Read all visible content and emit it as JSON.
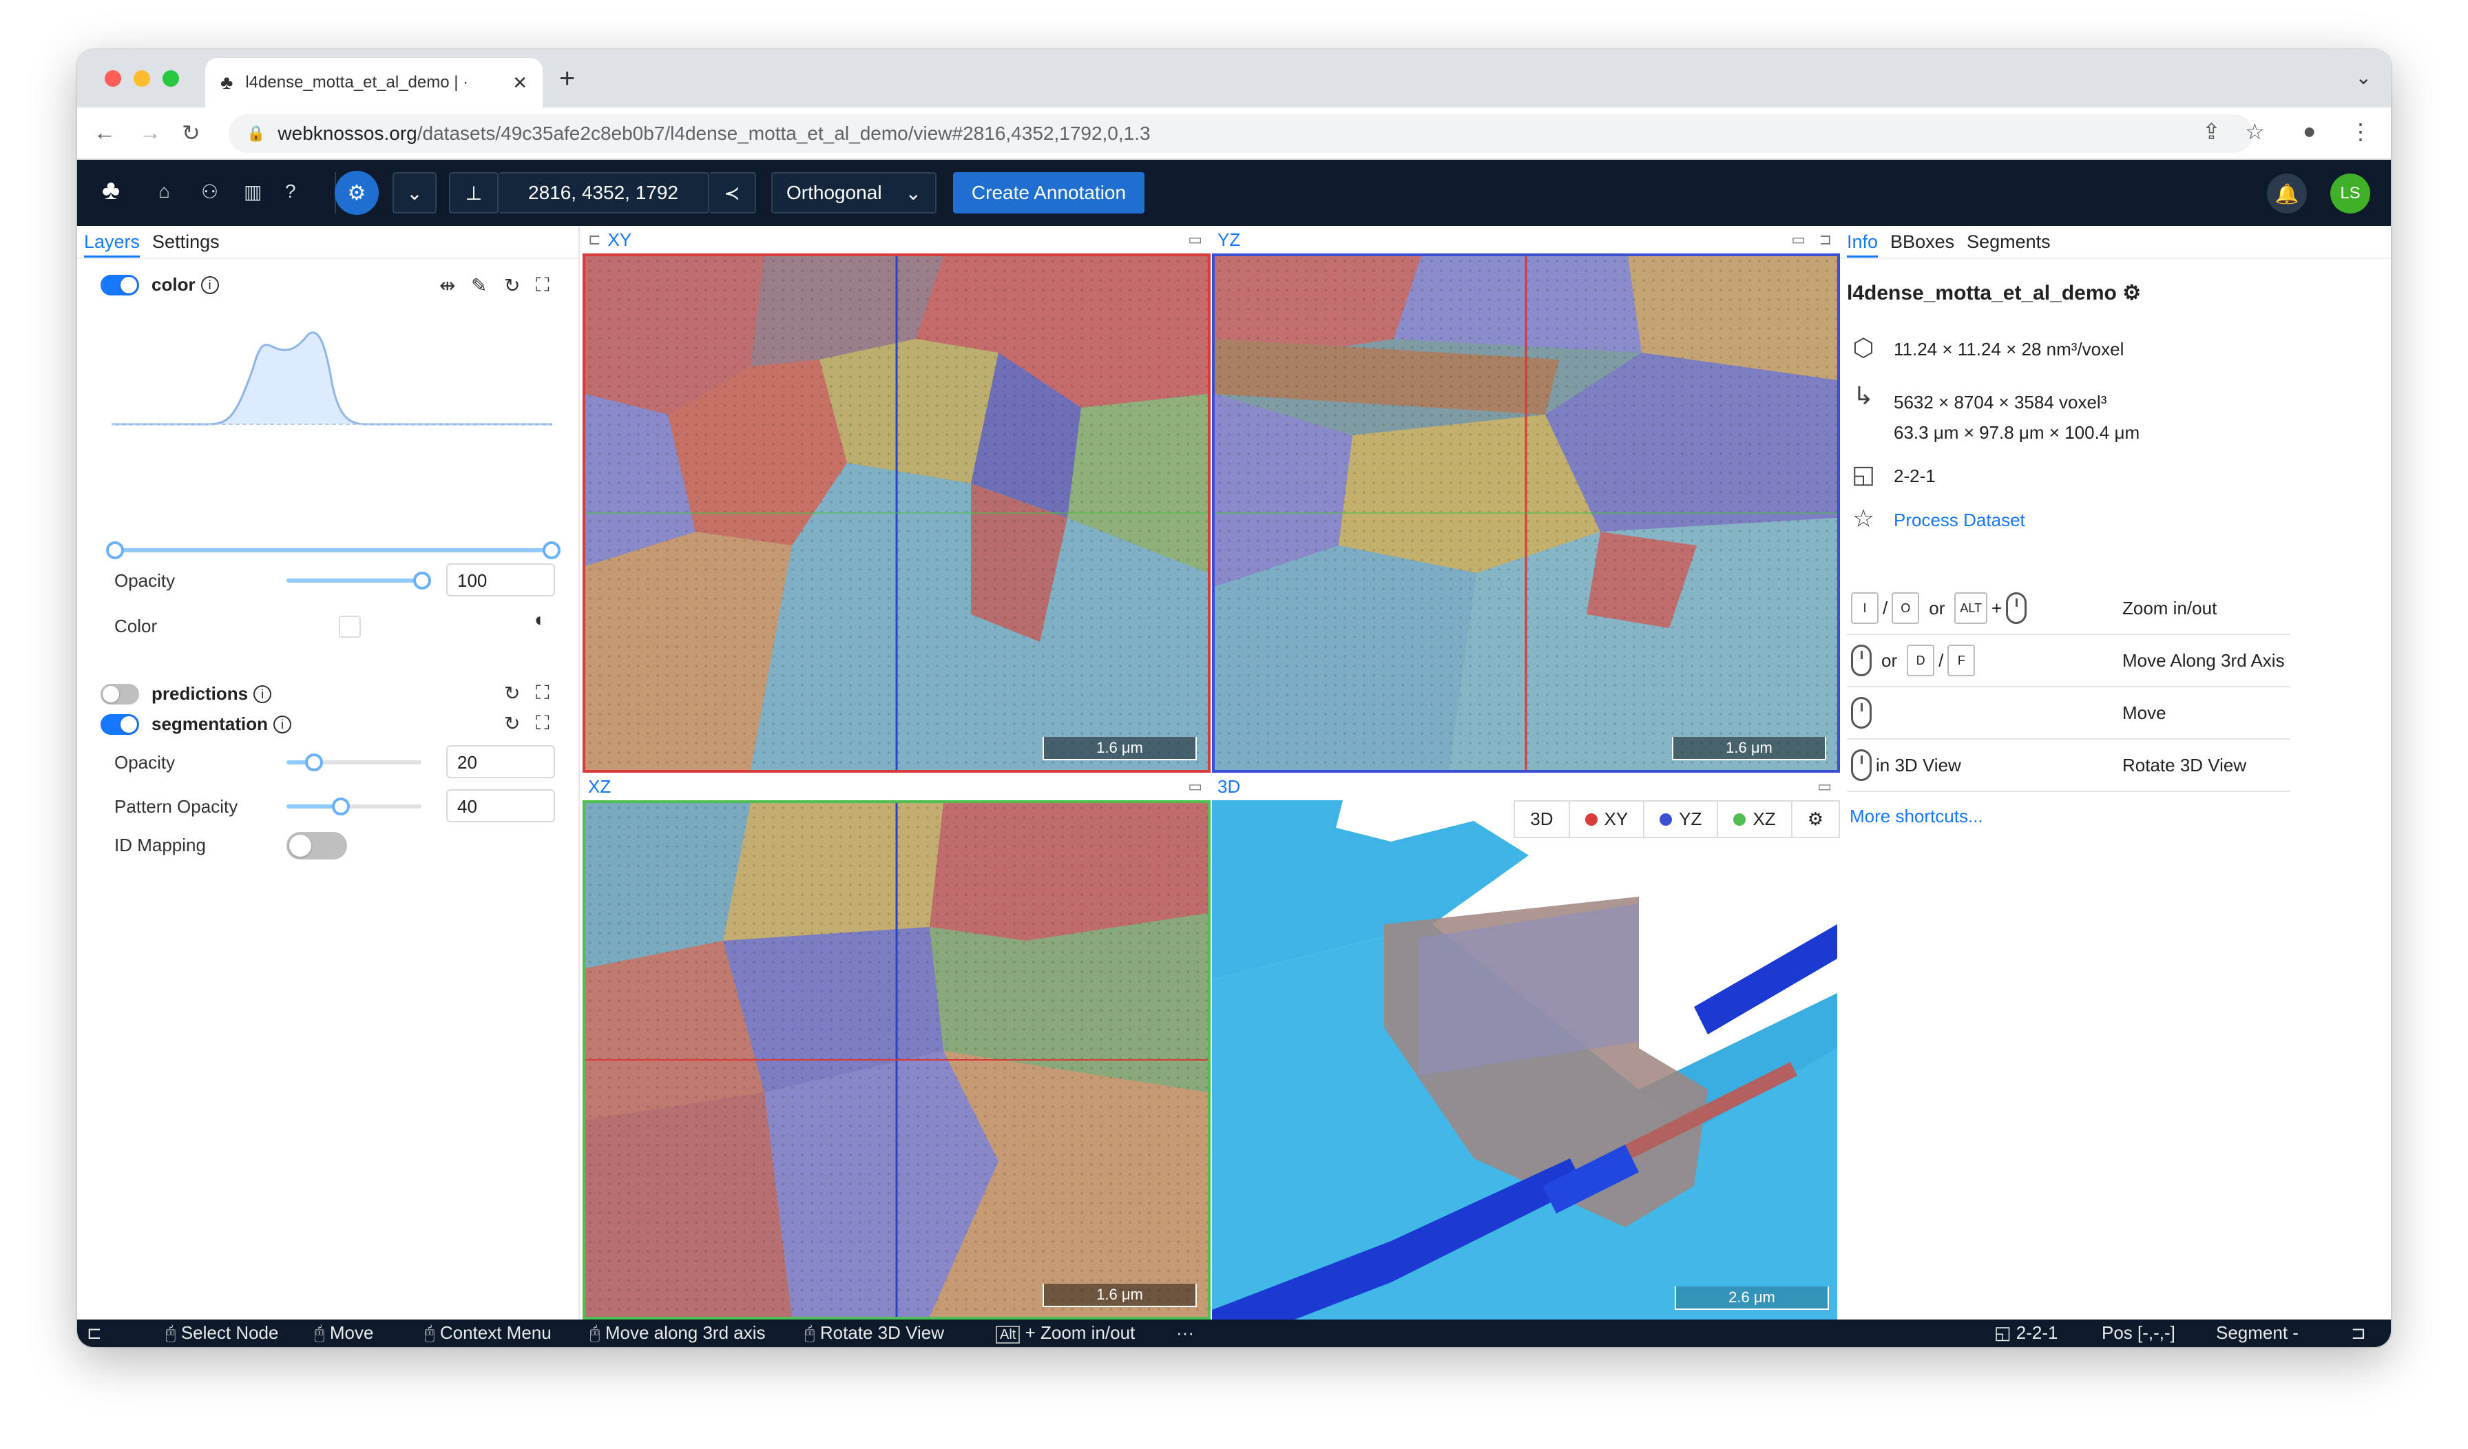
{
  "browser": {
    "tab_title": "l4dense_motta_et_al_demo | ·",
    "new_tab": "+",
    "url_domain": "webknossos.org",
    "url_path": "/datasets/49c35afe2c8eb0b7/l4dense_motta_et_al_demo/view#2816,4352,1792,0,1.3"
  },
  "navbar": {
    "position": "2816, 4352, 1792",
    "view_mode": "Orthogonal",
    "create_annotation": "Create Annotation",
    "user_initials": "LS"
  },
  "left_panel": {
    "tabs": [
      "Layers",
      "Settings"
    ],
    "color_layer": {
      "name": "color",
      "enabled": true,
      "opacity_label": "Opacity",
      "opacity": "100",
      "color_label": "Color"
    },
    "predictions_layer": {
      "name": "predictions",
      "enabled": false
    },
    "segmentation_layer": {
      "name": "segmentation",
      "enabled": true,
      "opacity_label": "Opacity",
      "opacity": "20",
      "pattern_label": "Pattern Opacity",
      "pattern_opacity": "40",
      "id_mapping_label": "ID Mapping",
      "id_mapping_enabled": false
    }
  },
  "viewports": {
    "xy": {
      "label": "XY",
      "scale": "1.6 μm",
      "border_color": "#d93a3a"
    },
    "yz": {
      "label": "YZ",
      "scale": "1.6 μm",
      "border_color": "#3a4fd1"
    },
    "xz": {
      "label": "XZ",
      "scale": "1.6 μm",
      "border_color": "#4fbf4f"
    },
    "td": {
      "label": "3D",
      "scale": "2.6 μm",
      "buttons": [
        "3D",
        "XY",
        "YZ",
        "XZ"
      ]
    }
  },
  "right_panel": {
    "tabs": [
      "Info",
      "BBoxes",
      "Segments"
    ],
    "dataset_name": "l4dense_motta_et_al_demo",
    "voxel_size": "11.24 × 11.24 × 28 nm³/voxel",
    "extent_voxel": "5632 × 8704 × 3584 voxel³",
    "extent_um": "63.3 μm × 97.8 μm × 100.4 μm",
    "mag": "2-2-1",
    "process": "Process Dataset",
    "shortcuts": {
      "zoom": {
        "k1": "I",
        "sep": "/",
        "k2": "O",
        "or": "or",
        "k3": "ALT",
        "plus": "+",
        "label": "Zoom in/out"
      },
      "move3rd": {
        "or": "or",
        "k1": "D",
        "sep": "/",
        "k2": "F",
        "label": "Move Along 3rd Axis"
      },
      "move": {
        "label": "Move"
      },
      "rotate": {
        "prefix": "in 3D View",
        "label": "Rotate 3D View"
      },
      "more": "More shortcuts..."
    }
  },
  "statusbar": {
    "select_node": "Select Node",
    "move": "Move",
    "context_menu": "Context Menu",
    "move_3rd": "Move along 3rd axis",
    "rotate": "Rotate 3D View",
    "alt": "Alt",
    "zoom": "+ Zoom in/out",
    "more": "···",
    "mag": "2-2-1",
    "pos": "Pos [-,-,-]",
    "segment": "Segment -"
  },
  "colors": {
    "accent": "#1677ff",
    "navbar": "#0c1a2b",
    "create_button": "#1f6fd1",
    "avatar": "#3fb027"
  }
}
